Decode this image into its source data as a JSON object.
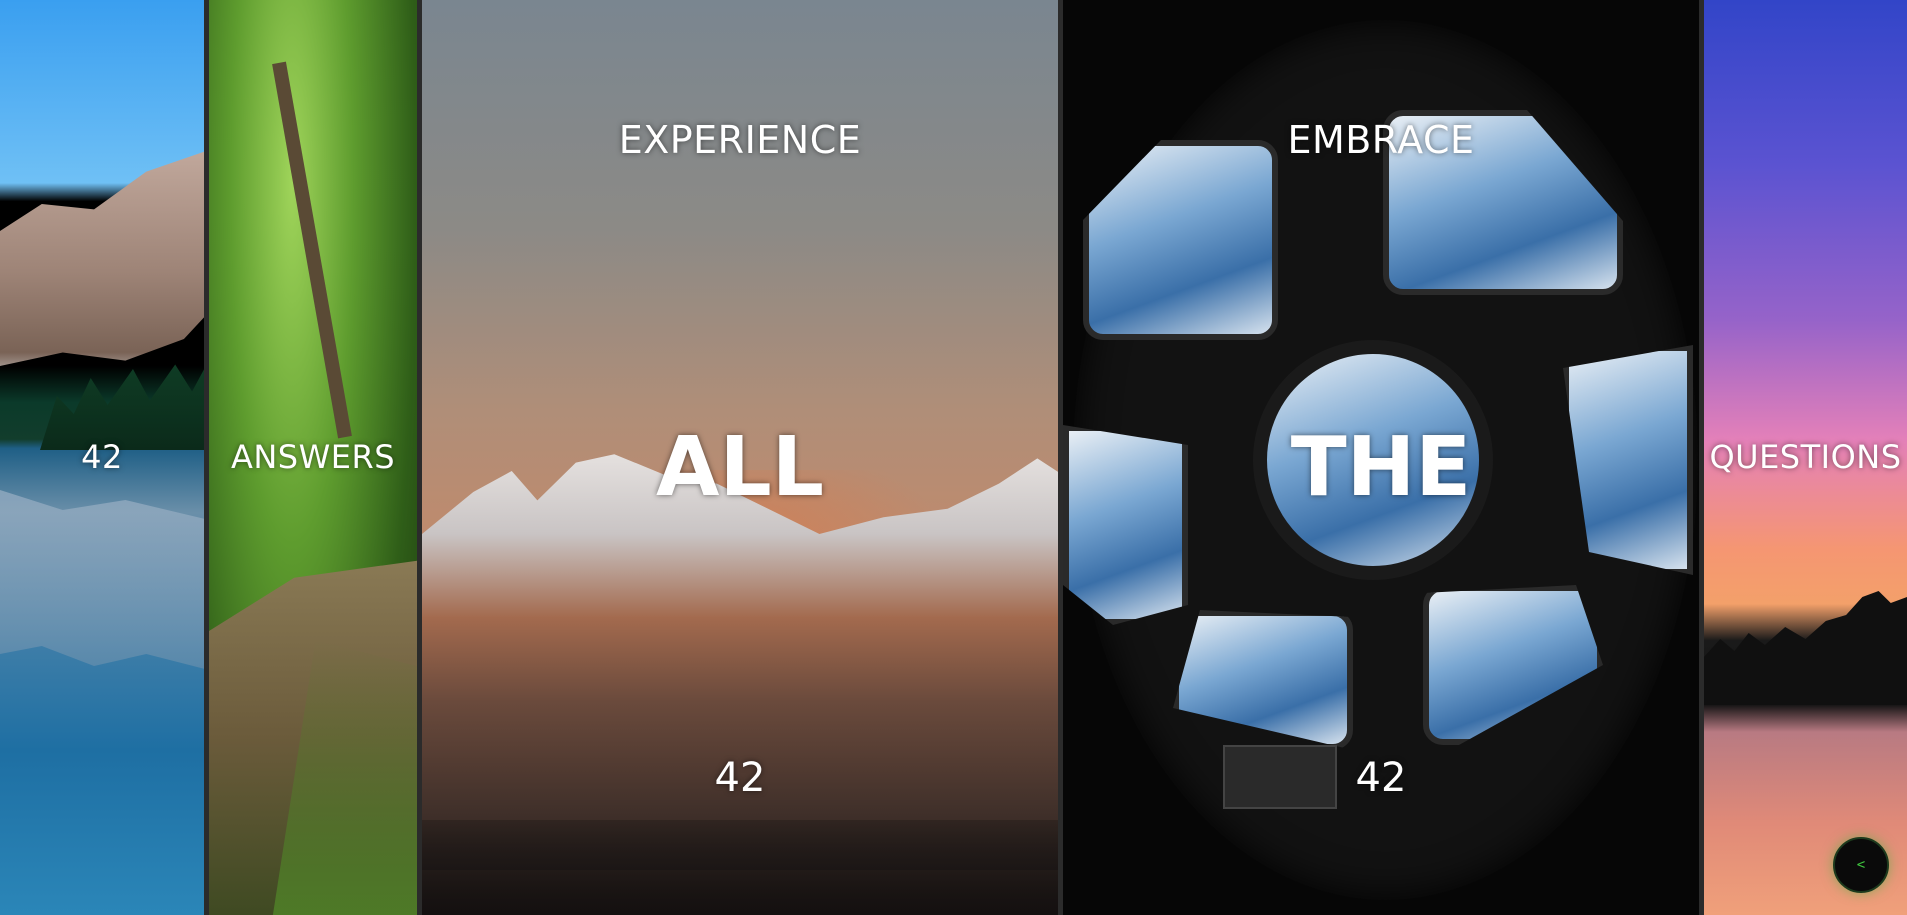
{
  "panels": [
    {
      "id": "lake",
      "mid": "42"
    },
    {
      "id": "forest",
      "mid": "ANSWERS"
    },
    {
      "id": "peaks",
      "top": "EXPERIENCE",
      "big": "ALL",
      "bottom": "42"
    },
    {
      "id": "cupola",
      "top": "EMBRACE",
      "big": "THE",
      "bottom": "42"
    },
    {
      "id": "sunset",
      "mid": "QUESTIONS"
    }
  ],
  "controls": {
    "back_icon_glyph": "<"
  }
}
